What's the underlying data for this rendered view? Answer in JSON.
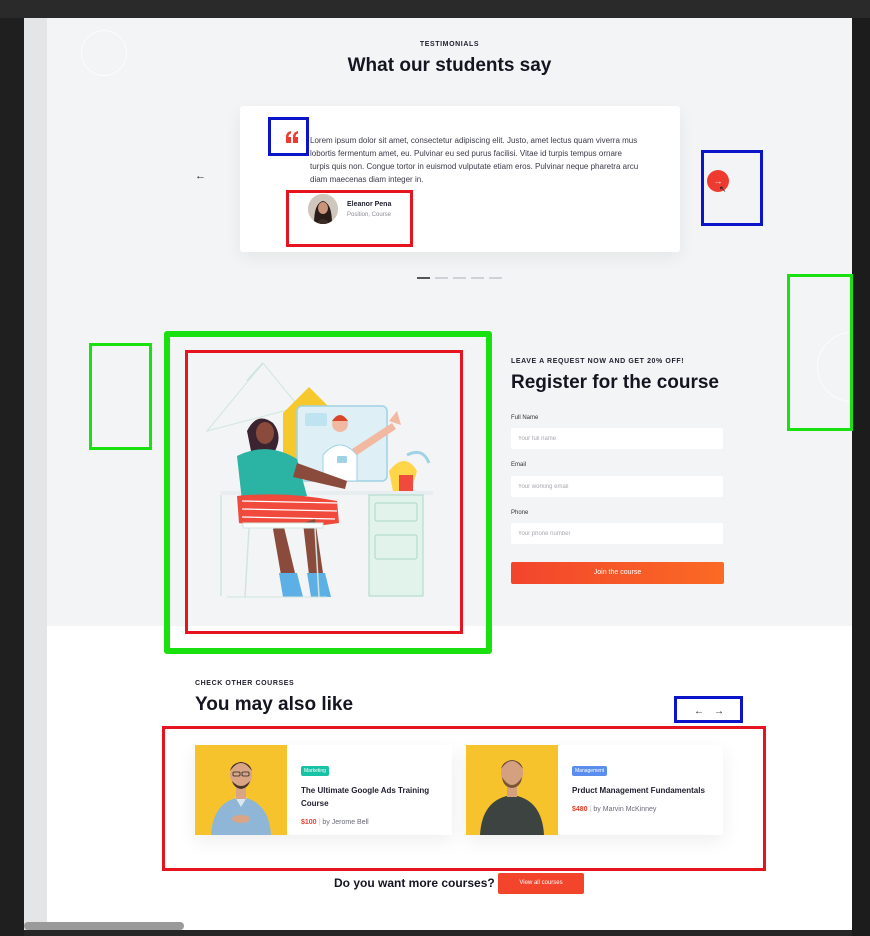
{
  "testimonials": {
    "eyebrow": "TESTIMONIALS",
    "heading": "What our students say",
    "quote": "Lorem ipsum dolor sit amet, consectetur adipiscing elit. Justo, amet lectus quam viverra mus lobortis fermentum amet, eu. Pulvinar eu sed purus facilisi. Vitae id turpis tempus ornare turpis quis non. Congue tortor in euismod vulputate etiam eros. Pulvinar neque pharetra arcu diam maecenas diam integer in.",
    "author_name": "Eleanor Pena",
    "author_role": "Position, Course",
    "prev_arrow": "←",
    "next_arrow": "→",
    "slide_count": 5,
    "active_slide": 1
  },
  "register": {
    "eyebrow": "LEAVE A REQUEST NOW AND GET 20% OFF!",
    "heading": "Register for the course",
    "fields": [
      {
        "label": "Full Name",
        "placeholder": "Your full name"
      },
      {
        "label": "Email",
        "placeholder": "Your working email"
      },
      {
        "label": "Phone",
        "placeholder": "Your phone number"
      }
    ],
    "submit_label": "Join the course"
  },
  "more_courses": {
    "eyebrow": "CHECK OTHER COURSES",
    "heading": "You may also like",
    "prev_arrow": "←",
    "next_arrow": "→",
    "courses": [
      {
        "tag": "Marketing",
        "tag_color": "#18c2a4",
        "title": "The Ultimate Google Ads Training Course",
        "price": "$100",
        "author": "by Jerome Bell"
      },
      {
        "tag": "Management",
        "tag_color": "#5b8def",
        "title": "Prduct Management Fundamentals",
        "price": "$480",
        "author": "by Marvin McKinney"
      }
    ],
    "cta_text": "Do you want more courses?",
    "cta_button": "View all courses"
  },
  "colors": {
    "accent": "#ef3b2f",
    "highlight_green": "#19e10f",
    "highlight_red": "#e5141e",
    "highlight_blue": "#0b14c9"
  }
}
